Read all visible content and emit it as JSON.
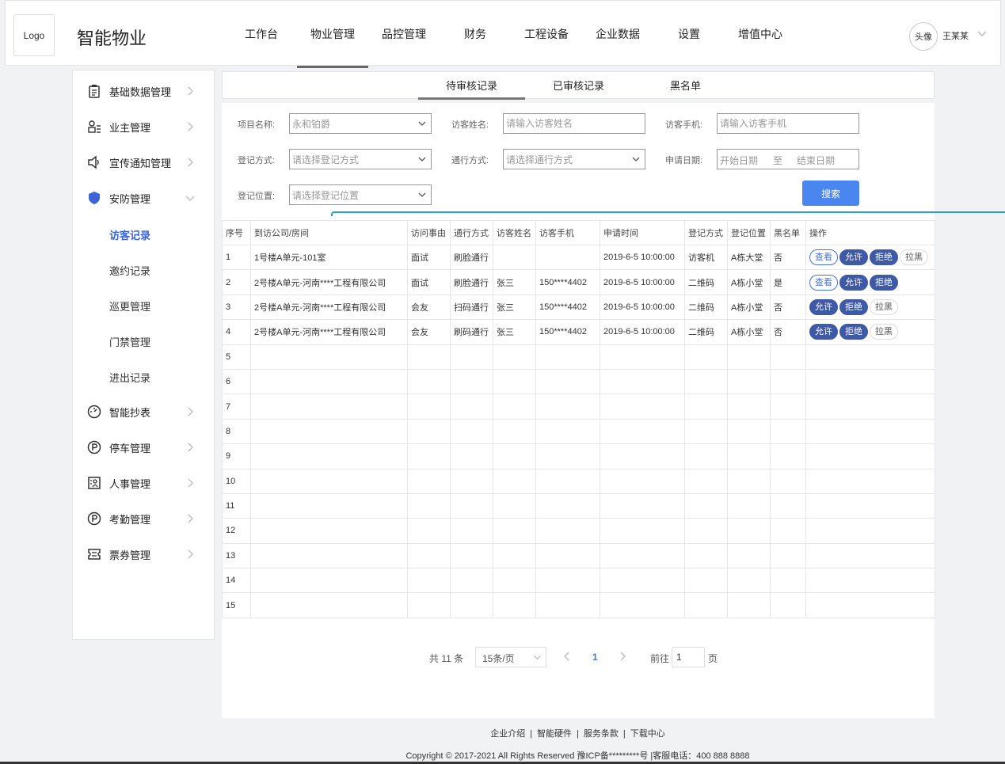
{
  "header": {
    "logo": "Logo",
    "brand": "智能物业",
    "nav": [
      "工作台",
      "物业管理",
      "品控管理",
      "财务",
      "工程设备",
      "企业数据",
      "设置",
      "增值中心"
    ],
    "active_nav": "物业管理",
    "avatar": "头像",
    "username": "王某某"
  },
  "sidebar": {
    "items": [
      {
        "label": "基础数据管理",
        "icon": "clipboard-icon"
      },
      {
        "label": "业主管理",
        "icon": "owner-icon"
      },
      {
        "label": "宣传通知管理",
        "icon": "speaker-icon"
      },
      {
        "label": "安防管理",
        "icon": "shield-icon"
      },
      {
        "label": "智能抄表",
        "icon": "meter-icon"
      },
      {
        "label": "停车管理",
        "icon": "parking-icon"
      },
      {
        "label": "人事管理",
        "icon": "personnel-icon"
      },
      {
        "label": "考勤管理",
        "icon": "attendance-icon"
      },
      {
        "label": "票券管理",
        "icon": "ticket-icon"
      }
    ],
    "sub_items": [
      "访客记录",
      "邀约记录",
      "巡更管理",
      "门禁管理",
      "进出记录"
    ],
    "active_sub": "访客记录"
  },
  "tabs": [
    "待审核记录",
    "已审核记录",
    "黑名单"
  ],
  "active_tab": "待审核记录",
  "filters": {
    "project_label": "项目名称:",
    "project_value": "永和铂爵",
    "visitor_name_label": "访客姓名:",
    "visitor_name_placeholder": "请输入访客姓名",
    "visitor_phone_label": "访客手机:",
    "visitor_phone_placeholder": "请输入访客手机",
    "register_method_label": "登记方式:",
    "register_method_placeholder": "请选择登记方式",
    "pass_method_label": "通行方式:",
    "pass_method_placeholder": "请选择通行方式",
    "apply_date_label": "申请日期:",
    "start_date": "开始日期",
    "date_sep": "至",
    "end_date": "结束日期",
    "register_location_label": "登记位置:",
    "register_location_placeholder": "请选择登记位置",
    "search_button": "搜索"
  },
  "table": {
    "columns": [
      "序号",
      "到访公司/房间",
      "访问事由",
      "通行方式",
      "访客姓名",
      "访客手机",
      "申请时间",
      "登记方式",
      "登记位置",
      "黑名单",
      "操作"
    ],
    "rows": [
      {
        "no": "1",
        "company": "1号楼A单元-101室",
        "reason": "面试",
        "pass": "刷脸通行",
        "name": "",
        "phone": "",
        "time": "2019-6-5 10:00:00",
        "method": "访客机",
        "location": "A栋大堂",
        "blacklist": "否",
        "actions": [
          "查看",
          "允许",
          "拒绝",
          "拉黑"
        ]
      },
      {
        "no": "2",
        "company": "2号楼A单元-河南****工程有限公司",
        "reason": "面试",
        "pass": "刷脸通行",
        "name": "张三",
        "phone": "150****4402",
        "time": "2019-6-5 10:00:00",
        "method": "二维码",
        "location": "A栋小堂",
        "blacklist": "是",
        "actions": [
          "查看",
          "允许",
          "拒绝"
        ]
      },
      {
        "no": "3",
        "company": "2号楼A单元-河南****工程有限公司",
        "reason": "会友",
        "pass": "扫码通行",
        "name": "张三",
        "phone": "150****4402",
        "time": "2019-6-5 10:00:00",
        "method": "二维码",
        "location": "A栋小堂",
        "blacklist": "否",
        "actions": [
          "允许",
          "拒绝",
          "拉黑"
        ]
      },
      {
        "no": "4",
        "company": "2号楼A单元-河南****工程有限公司",
        "reason": "会友",
        "pass": "刷码通行",
        "name": "张三",
        "phone": "150****4402",
        "time": "2019-6-5 10:00:00",
        "method": "二维码",
        "location": "A栋小堂",
        "blacklist": "否",
        "actions": [
          "允许",
          "拒绝",
          "拉黑"
        ]
      },
      {
        "no": "5"
      },
      {
        "no": "6"
      },
      {
        "no": "7"
      },
      {
        "no": "8"
      },
      {
        "no": "9"
      },
      {
        "no": "10"
      },
      {
        "no": "11"
      },
      {
        "no": "12"
      },
      {
        "no": "13"
      },
      {
        "no": "14"
      },
      {
        "no": "15"
      }
    ]
  },
  "pagination": {
    "total": "共 11 条",
    "page_size": "15条/页",
    "current": "1",
    "goto_label": "前往",
    "goto_value": "1",
    "goto_unit": "页"
  },
  "footer": {
    "links": [
      "企业介绍",
      "智能硬件",
      "服务条款",
      "下载中心"
    ],
    "copyright": "Copyright  ©  2017-2021    All Rights Reserved  豫ICP备*********号  |客服电话：400 888 8888"
  }
}
